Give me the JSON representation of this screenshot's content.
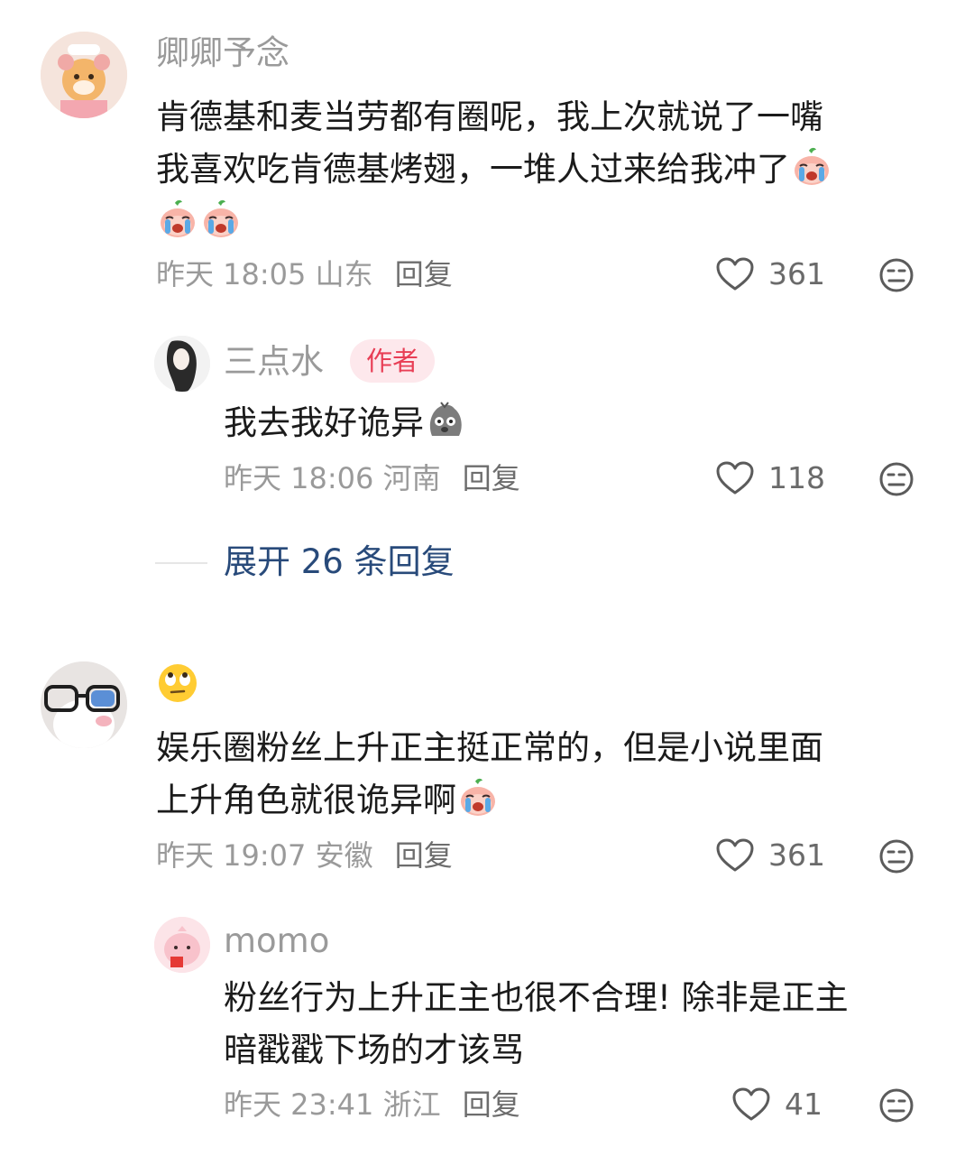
{
  "comments": [
    {
      "username": "卿卿予念",
      "text_lines": [
        "肯德基和麦当劳都有圈呢，我上次就说了一嘴",
        "我喜欢吃肯德基烤翅，一堆人过来给我冲了"
      ],
      "time": "昨天 18:05 山东",
      "reply_label": "回复",
      "likes": "361",
      "replies": [
        {
          "username": "三点水",
          "badge": "作者",
          "text": "我去我好诡异",
          "time": "昨天 18:06 河南",
          "reply_label": "回复",
          "likes": "118"
        }
      ],
      "expand_label": "展开 26 条回复"
    },
    {
      "username": "",
      "text_lines": [
        "娱乐圈粉丝上升正主挺正常的，但是小说里面",
        "上升角色就很诡异啊"
      ],
      "time": "昨天 19:07 安徽",
      "reply_label": "回复",
      "likes": "361",
      "replies": [
        {
          "username": "momo",
          "text_lines": [
            "粉丝行为上升正主也很不合理! 除非是正主",
            "暗戳戳下场的才该骂"
          ],
          "time": "昨天 23:41 浙江",
          "reply_label": "回复",
          "likes": "41"
        }
      ]
    }
  ],
  "colors": {
    "name": "#9a9a9a",
    "text": "#1b1b1b",
    "badge_bg": "#fde8ec",
    "badge_fg": "#e83e55",
    "expand": "#284a7a"
  },
  "icons": [
    "heart-outline-icon",
    "dislike-face-icon",
    "crying-peach-emoji",
    "stone-face-emoji",
    "eye-roll-emoji"
  ]
}
